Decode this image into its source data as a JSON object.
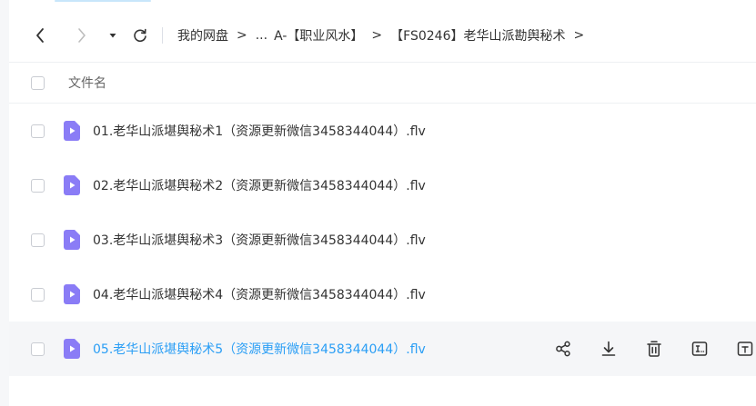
{
  "breadcrumb": {
    "items": [
      "我的网盘",
      "...",
      "A-【职业风水】",
      "【FS0246】老华山派勘舆秘术"
    ],
    "separator": ">",
    "trailing_separator": ">"
  },
  "list": {
    "header_label": "文件名",
    "files": [
      {
        "name": "01.老华山派堪舆秘术1（资源更新微信3458344044）.flv"
      },
      {
        "name": "02.老华山派堪舆秘术2（资源更新微信3458344044）.flv"
      },
      {
        "name": "03.老华山派堪舆秘术3（资源更新微信3458344044）.flv"
      },
      {
        "name": "04.老华山派堪舆秘术4（资源更新微信3458344044）.flv"
      },
      {
        "name": "05.老华山派堪舆秘术5（资源更新微信3458344044）.flv"
      }
    ],
    "hovered_index": 4
  },
  "icons": {
    "file": "video-file-icon",
    "row_actions": [
      "share-icon",
      "download-icon",
      "delete-icon",
      "rename-icon",
      "more-icon"
    ]
  },
  "colors": {
    "accent": "#2a9ef5",
    "file_icon": "#8a7cf6",
    "hover_row": "#f5f6f8"
  }
}
